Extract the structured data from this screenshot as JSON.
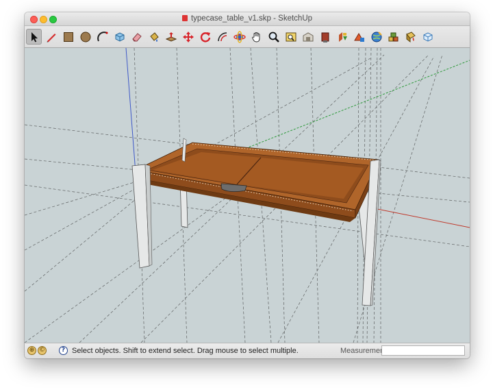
{
  "window": {
    "title": "typecase_table_v1.skp - SketchUp"
  },
  "toolbar": {
    "tools": [
      {
        "name": "select-tool",
        "icon": "arrow-cursor-icon",
        "active": true
      },
      {
        "name": "line-tool",
        "icon": "pencil-icon"
      },
      {
        "name": "rectangle-tool",
        "icon": "rectangle-icon"
      },
      {
        "name": "circle-tool",
        "icon": "circle-icon"
      },
      {
        "name": "arc-tool",
        "icon": "arc-icon"
      },
      {
        "name": "make-component-tool",
        "icon": "component-box-icon"
      },
      {
        "name": "eraser-tool",
        "icon": "eraser-icon"
      },
      {
        "name": "paint-bucket-tool",
        "icon": "paint-bucket-icon"
      },
      {
        "name": "push-pull-tool",
        "icon": "push-pull-icon"
      },
      {
        "name": "move-tool",
        "icon": "move-arrows-icon"
      },
      {
        "name": "rotate-tool",
        "icon": "rotate-icon"
      },
      {
        "name": "offset-tool",
        "icon": "offset-icon"
      },
      {
        "name": "orbit-tool",
        "icon": "orbit-icon"
      },
      {
        "name": "pan-tool",
        "icon": "hand-icon"
      },
      {
        "name": "zoom-tool",
        "icon": "magnifier-icon"
      },
      {
        "name": "zoom-extents-tool",
        "icon": "zoom-extents-icon"
      },
      {
        "name": "3d-warehouse-button",
        "icon": "warehouse-icon"
      },
      {
        "name": "share-model-button",
        "icon": "share-model-icon"
      },
      {
        "name": "get-models-button",
        "icon": "get-models-icon"
      },
      {
        "name": "extension-warehouse-button",
        "icon": "extension-warehouse-icon"
      },
      {
        "name": "layout-button",
        "icon": "globe-icon"
      },
      {
        "name": "components-button",
        "icon": "components-icon"
      },
      {
        "name": "materials-button",
        "icon": "materials-icon"
      },
      {
        "name": "styles-button",
        "icon": "styles-icon"
      }
    ]
  },
  "statusbar": {
    "message": "Select objects. Shift to extend select. Drag mouse to select multiple.",
    "measurements_label": "Measurements",
    "measurements_value": "",
    "icons": [
      "geo-location-icon",
      "credits-icon",
      "help-icon"
    ]
  },
  "colors": {
    "viewport_bg": "#c9d3d5",
    "wood": "#a45a22",
    "wood_dark": "#6e3a12",
    "legs": "#e6e8e8",
    "axis_red": "#c0392b",
    "axis_green": "#2e9a3b",
    "axis_blue": "#3f59c8"
  }
}
